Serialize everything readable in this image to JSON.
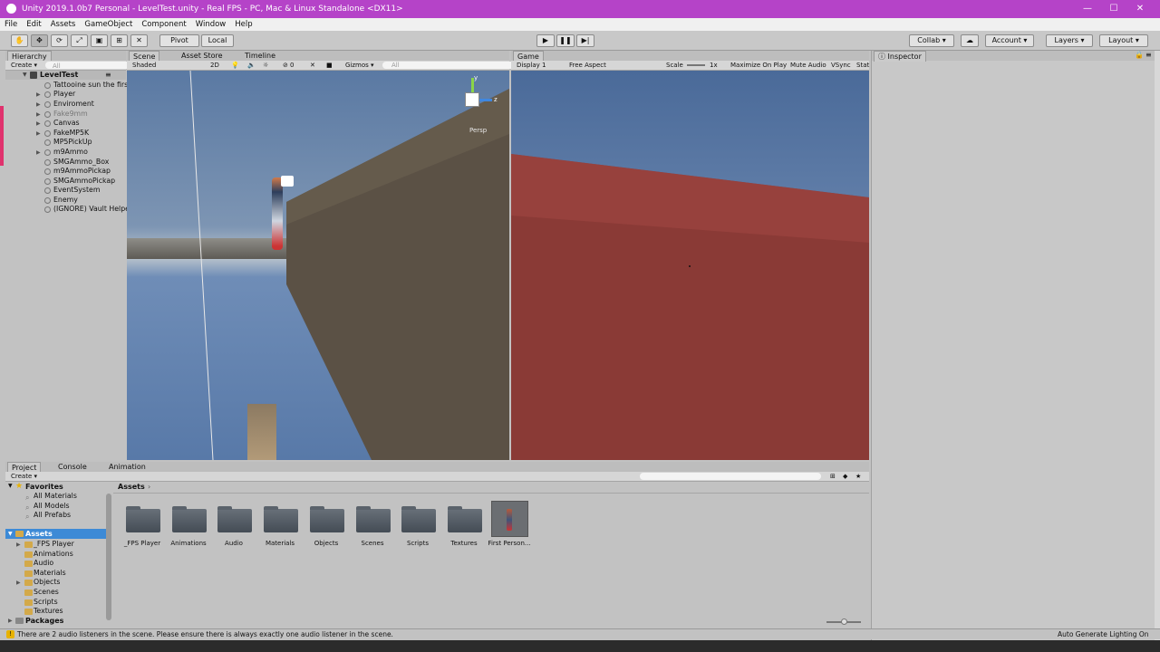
{
  "window": {
    "title": "Unity 2019.1.0b7 Personal - LevelTest.unity - Real FPS - PC, Mac & Linux Standalone <DX11>",
    "minimize": "—",
    "maximize": "☐",
    "close": "✕"
  },
  "menu": [
    "File",
    "Edit",
    "Assets",
    "GameObject",
    "Component",
    "Window",
    "Help"
  ],
  "toolbar": {
    "pivot": "Pivot",
    "local": "Local",
    "collab": "Collab ▾",
    "account": "Account ▾",
    "layers": "Layers ▾",
    "layout": "Layout ▾"
  },
  "hierarchy": {
    "tab": "Hierarchy",
    "create": "Create ▾",
    "search_placeholder": "All",
    "scene": "LevelTest",
    "items": [
      "Tattooine sun the first",
      "Player",
      "Enviroment",
      "Fake9mm",
      "Canvas",
      "FakeMP5K",
      "MP5PickUp",
      "m9Ammo",
      "SMGAmmo_Box",
      "m9AmmoPickap",
      "SMGAmmoPickap",
      "EventSystem",
      "Enemy",
      "(IGNORE) Vault Helper"
    ]
  },
  "scene": {
    "tabs": [
      "Scene",
      "Asset Store",
      "Timeline"
    ],
    "shading": "Shaded",
    "mode_2d": "2D",
    "gizmos": "Gizmos ▾",
    "search_placeholder": "All",
    "persp": "Persp",
    "fx_count": "0",
    "axis_y": "y",
    "axis_z": "z"
  },
  "game": {
    "tab": "Game",
    "display": "Display 1",
    "aspect": "Free Aspect",
    "scale_label": "Scale",
    "scale_value": "1x",
    "maximize": "Maximize On Play",
    "mute": "Mute Audio",
    "vsync": "VSync",
    "stats": "Stat"
  },
  "inspector": {
    "tab": "Inspector"
  },
  "project": {
    "tabs": [
      "Project",
      "Console",
      "Animation"
    ],
    "create": "Create ▾",
    "favorites": "Favorites",
    "fav_items": [
      "All Materials",
      "All Models",
      "All Prefabs"
    ],
    "assets": "Assets",
    "asset_items": [
      "_FPS Player",
      "Animations",
      "Audio",
      "Materials",
      "Objects",
      "Scenes",
      "Scripts",
      "Textures"
    ],
    "packages": "Packages",
    "breadcrumb": "Assets",
    "grid": [
      "_FPS Player",
      "Animations",
      "Audio",
      "Materials",
      "Objects",
      "Scenes",
      "Scripts",
      "Textures",
      "First Person..."
    ]
  },
  "status": {
    "message": "There are 2 audio listeners in the scene. Please ensure there is always exactly one audio listener in the scene.",
    "right": "Auto Generate Lighting On"
  }
}
